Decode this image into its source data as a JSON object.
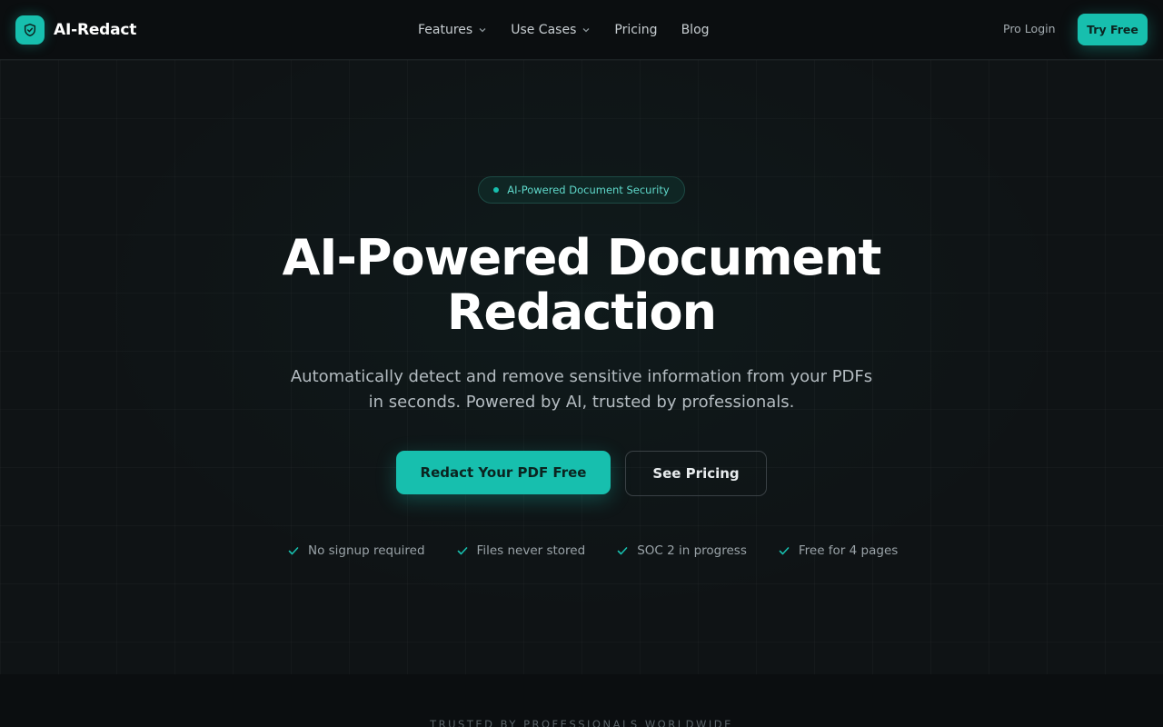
{
  "nav": {
    "brand": "AI-Redact",
    "links": [
      {
        "label": "Features",
        "dropdown": true
      },
      {
        "label": "Use Cases",
        "dropdown": true
      },
      {
        "label": "Pricing",
        "dropdown": false
      },
      {
        "label": "Blog",
        "dropdown": false
      }
    ],
    "pro_login": "Pro Login",
    "try_free": "Try Free"
  },
  "hero": {
    "badge": "AI-Powered Document Security",
    "headline_line1": "AI-Powered Document",
    "headline_line2": "Redaction",
    "subtitle_line1": "Automatically detect and remove sensitive information from your PDFs",
    "subtitle_line2": "in seconds. Powered by AI, trusted by professionals.",
    "cta_primary": "Redact Your PDF Free",
    "cta_secondary": "See Pricing",
    "features": [
      "No signup required",
      "Files never stored",
      "SOC 2 in progress",
      "Free for 4 pages"
    ]
  },
  "trusted": {
    "label": "TRUSTED BY PROFESSIONALS WORLDWIDE"
  },
  "colors": {
    "accent": "#17bfae",
    "background": "#0f1315",
    "nav_background": "#0b0e10"
  },
  "icons": {
    "logo": "shield-check-icon",
    "dropdown": "chevron-down-icon",
    "feature": "check-icon"
  }
}
